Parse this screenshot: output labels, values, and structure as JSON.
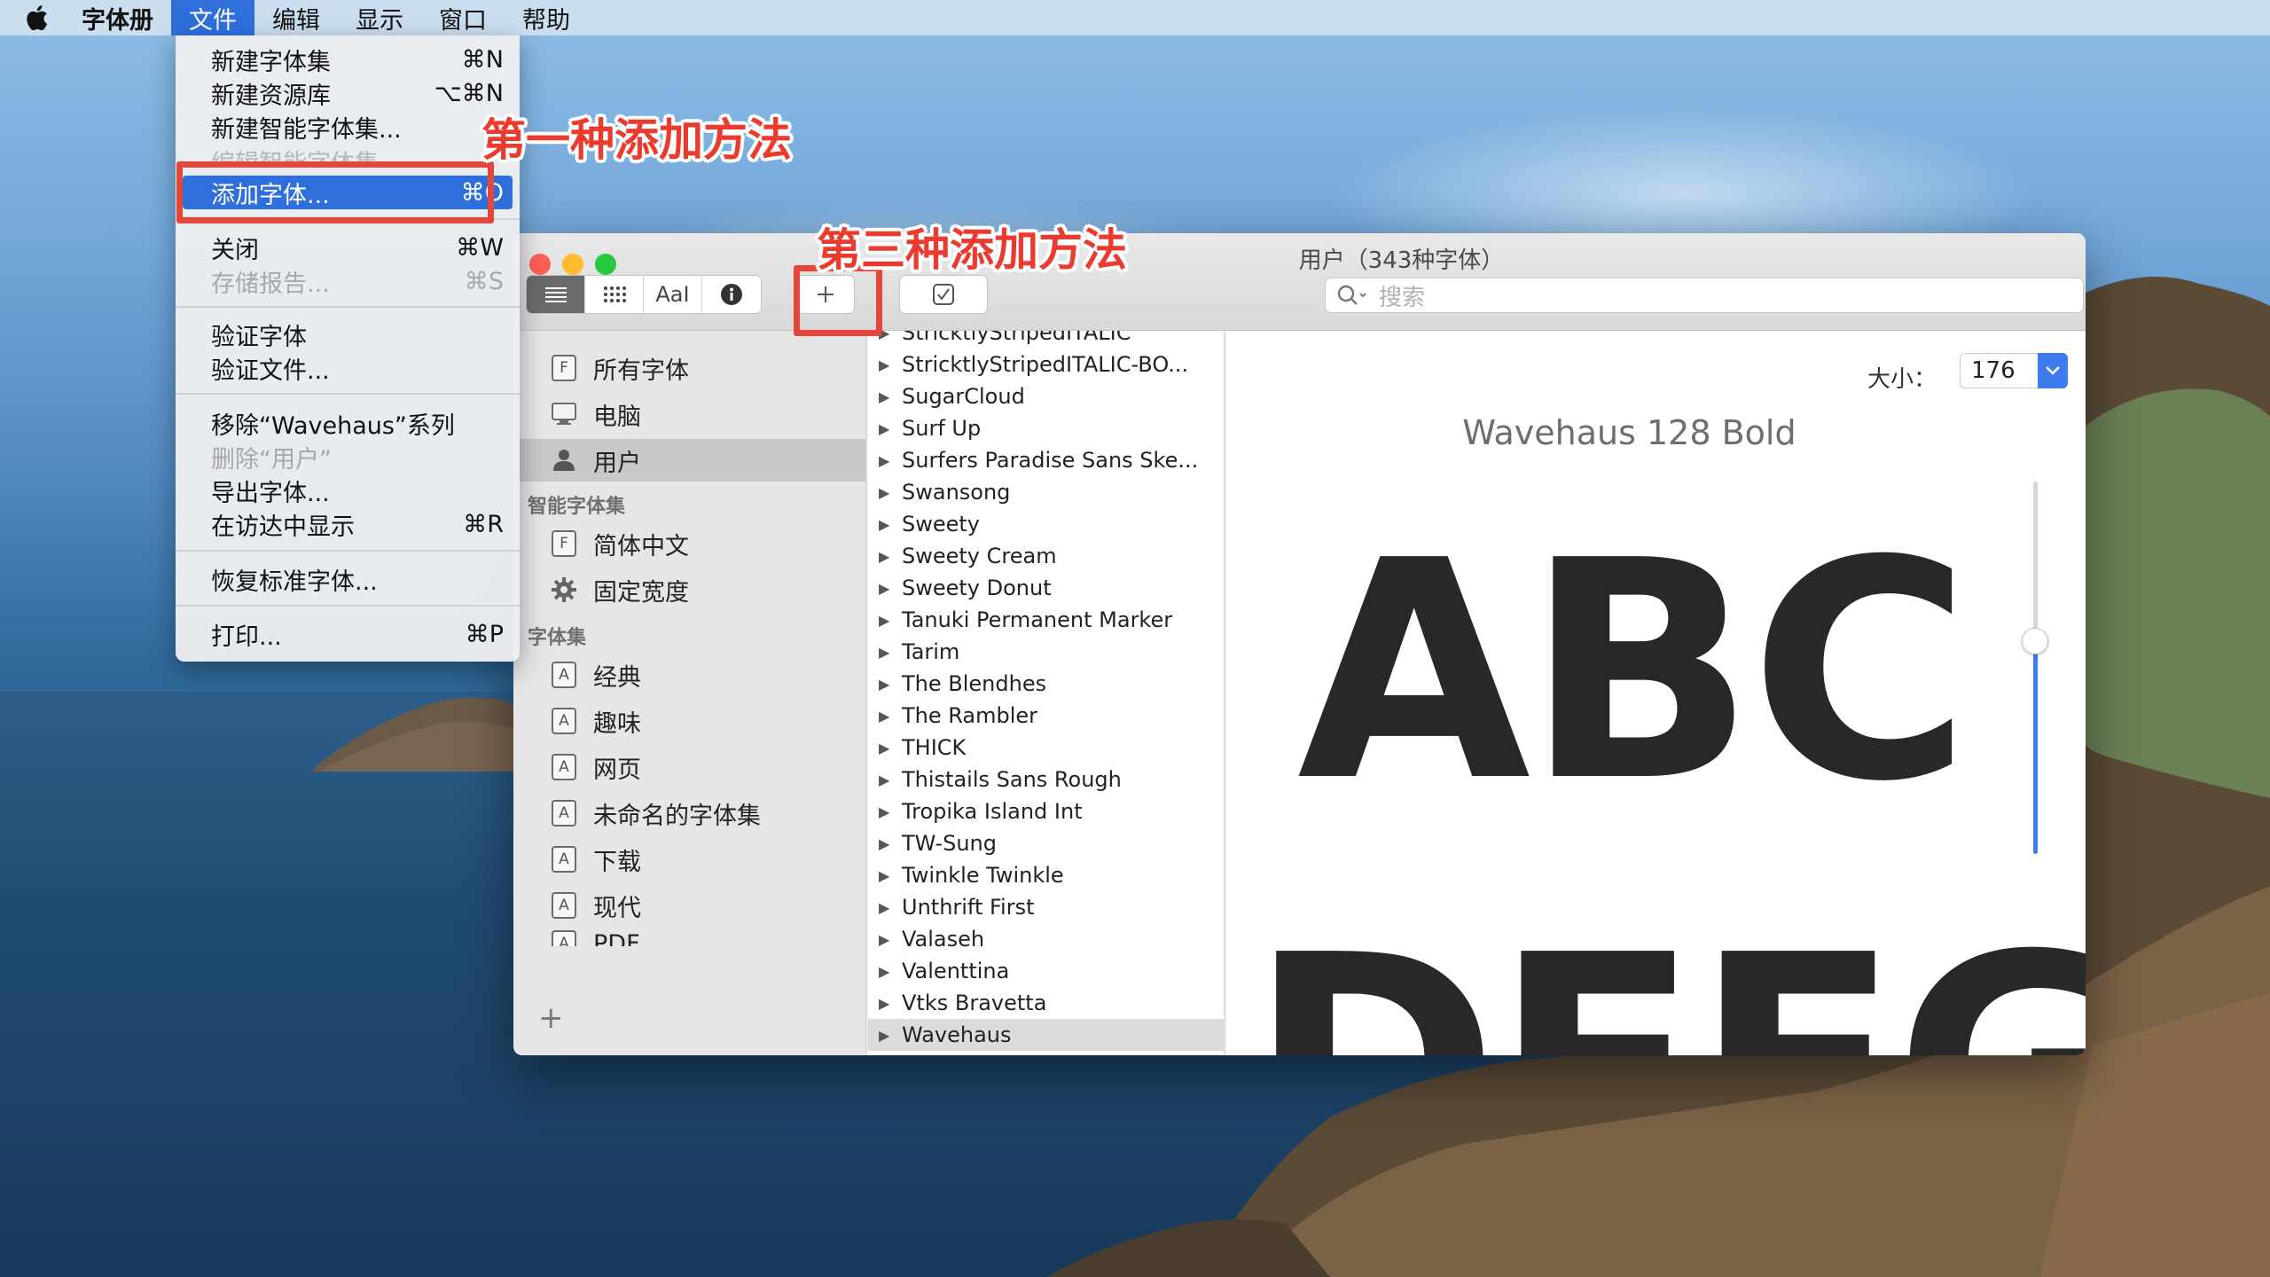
{
  "menubar": {
    "app_name": "字体册",
    "items": [
      "文件",
      "编辑",
      "显示",
      "窗口",
      "帮助"
    ],
    "active_item": "文件"
  },
  "file_menu": {
    "items": [
      {
        "label": "新建字体集",
        "shortcut": "⌘N",
        "enabled": true
      },
      {
        "label": "新建资源库",
        "shortcut": "⌥⌘N",
        "enabled": true
      },
      {
        "label": "新建智能字体集...",
        "shortcut": "",
        "enabled": true
      },
      {
        "label": "编辑智能字体集",
        "shortcut": "",
        "enabled": false
      },
      {
        "label": "添加字体...",
        "shortcut": "⌘O",
        "enabled": true,
        "selected": true
      },
      {
        "label": "关闭",
        "shortcut": "⌘W",
        "enabled": true
      },
      {
        "label": "存储报告...",
        "shortcut": "⌘S",
        "enabled": false
      },
      {
        "label": "验证字体",
        "shortcut": "",
        "enabled": true
      },
      {
        "label": "验证文件...",
        "shortcut": "",
        "enabled": true
      },
      {
        "label": "移除“Wavehaus”系列",
        "shortcut": "",
        "enabled": true
      },
      {
        "label": "删除“用户”",
        "shortcut": "",
        "enabled": false
      },
      {
        "label": "导出字体...",
        "shortcut": "",
        "enabled": true
      },
      {
        "label": "在访达中显示",
        "shortcut": "⌘R",
        "enabled": true
      },
      {
        "label": "恢复标准字体...",
        "shortcut": "",
        "enabled": true
      },
      {
        "label": "打印...",
        "shortcut": "⌘P",
        "enabled": true
      }
    ]
  },
  "annotations": {
    "first_method": "第一种添加方法",
    "third_method": "第三种添加方法"
  },
  "window": {
    "title": "用户（343种字体）",
    "search_placeholder": "搜索",
    "toolbar": {
      "view_buttons": [
        "list-view",
        "grid-view",
        "sample-view",
        "info-view"
      ],
      "sample_label": "AaI",
      "add_label": "+",
      "validate_icon": "checkbox-icon"
    },
    "sidebar": {
      "items": [
        {
          "label": "所有字体",
          "icon": "font-file-icon"
        },
        {
          "label": "电脑",
          "icon": "computer-icon"
        },
        {
          "label": "用户",
          "icon": "user-icon",
          "selected": true
        }
      ],
      "smart_header": "智能字体集",
      "smart_items": [
        {
          "label": "简体中文",
          "icon": "font-file-icon"
        },
        {
          "label": "固定宽度",
          "icon": "gear-icon"
        }
      ],
      "collections_header": "字体集",
      "collections": [
        {
          "label": "经典"
        },
        {
          "label": "趣味"
        },
        {
          "label": "网页"
        },
        {
          "label": "未命名的字体集"
        },
        {
          "label": "下载"
        },
        {
          "label": "现代"
        },
        {
          "label": "PDF"
        }
      ],
      "add_label": "+"
    },
    "font_list": [
      "StricktlyStripedITALIC",
      "StricktlyStripedITALIC-BO...",
      "SugarCloud",
      "Surf Up",
      "Surfers Paradise Sans Ske...",
      "Swansong",
      "Sweety",
      "Sweety Cream",
      "Sweety Donut",
      "Tanuki Permanent Marker",
      "Tarim",
      "The Blendhes",
      "The Rambler",
      "THICK",
      "Thistails Sans Rough",
      "Tropika Island Int",
      "TW-Sung",
      "Twinkle Twinkle",
      "Unthrift First",
      "Valaseh",
      "Valenttina",
      "Vtks Bravetta",
      "Wavehaus"
    ],
    "selected_font": "Wavehaus",
    "preview": {
      "size_label": "大小：",
      "size_value": "176",
      "font_title": "Wavehaus 128 Bold",
      "sample_line_1": "ABC",
      "sample_line_2": "DEFG",
      "size_slider_fraction": 0.58
    }
  },
  "colors": {
    "accent": "#2f6fdc",
    "annotation_red": "#ec3b2e",
    "close": "#fe5f57",
    "minimize": "#febc2e",
    "zoom": "#28c840"
  }
}
